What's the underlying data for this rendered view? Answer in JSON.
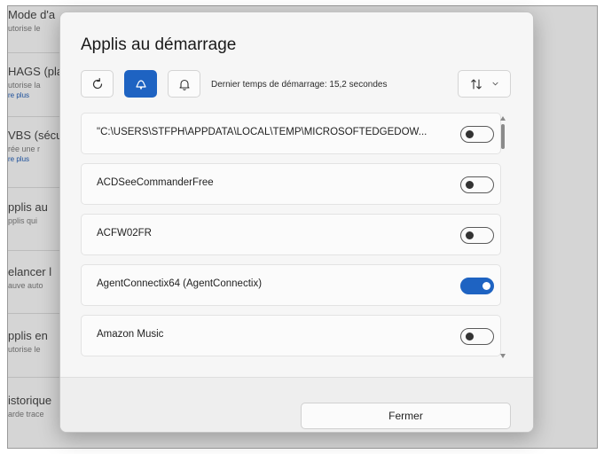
{
  "background": {
    "items": [
      {
        "title": "Mode d'a",
        "sub": "utorise le",
        "link": ""
      },
      {
        "title": "HAGS (pla",
        "sub": "utorise la",
        "link": "re plus"
      },
      {
        "title": "VBS (sécu",
        "sub": "rée une r",
        "link": "re plus"
      },
      {
        "title": "pplis au",
        "sub": "pplis qui",
        "link": ""
      },
      {
        "title": "elancer l",
        "sub": "auve auto",
        "link": ""
      },
      {
        "title": "pplis en",
        "sub": "utorise le",
        "link": ""
      },
      {
        "title": "istorique",
        "sub": "arde trace",
        "link": ""
      }
    ]
  },
  "dialog": {
    "title": "Applis au démarrage",
    "toolbar": {
      "refresh_icon": "refresh-icon",
      "startup_icon": "startup-apps-icon",
      "notification_icon": "bell-icon",
      "boot_time": "Dernier temps de démarrage: 15,2 secondes",
      "sort_icon": "sort-arrows-icon",
      "sort_chevron_icon": "chevron-down-icon"
    },
    "apps": [
      {
        "name": "\"C:\\USERS\\STFPH\\APPDATA\\LOCAL\\TEMP\\MICROSOFTEDGEDOW...",
        "enabled": false
      },
      {
        "name": "ACDSeeCommanderFree",
        "enabled": false
      },
      {
        "name": "ACFW02FR",
        "enabled": false
      },
      {
        "name": "AgentConnectix64 (AgentConnectix)",
        "enabled": true
      },
      {
        "name": "Amazon Music",
        "enabled": false
      }
    ],
    "close_label": "Fermer"
  },
  "colors": {
    "accent": "#1e63c2",
    "dialog_bg": "#f6f6f6",
    "backdrop": "#d5d5d5"
  }
}
